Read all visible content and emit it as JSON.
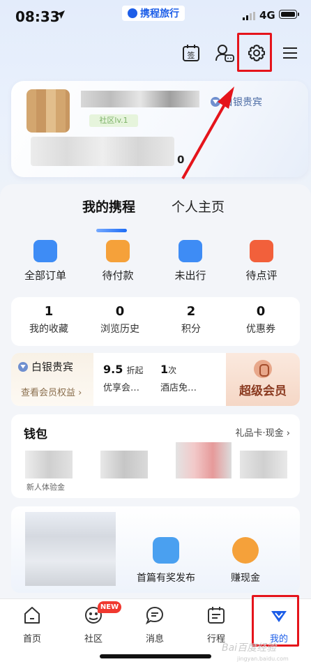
{
  "status": {
    "time": "08:33",
    "network": "4G"
  },
  "brand": {
    "name": "携程旅行"
  },
  "profile": {
    "level_tag": "社区lv.1",
    "vip_label": "白银贵宾",
    "zero_value": "0"
  },
  "tabs": {
    "active": "我的携程",
    "other": "个人主页"
  },
  "orders": [
    {
      "label": "全部订单",
      "color": "#3e8cf5"
    },
    {
      "label": "待付款",
      "color": "#f5a13a"
    },
    {
      "label": "未出行",
      "color": "#3e8cf5"
    },
    {
      "label": "待点评",
      "color": "#f2603b"
    }
  ],
  "stats": [
    {
      "num": "1",
      "label": "我的收藏"
    },
    {
      "num": "0",
      "label": "浏览历史"
    },
    {
      "num": "2",
      "label": "积分"
    },
    {
      "num": "0",
      "label": "优惠券"
    }
  ],
  "member": {
    "tier": "白银贵宾",
    "see_rights": "查看会员权益 ›",
    "benefit1_big": "9.5",
    "benefit1_small": "折起",
    "benefit1_desc": "优享会…",
    "benefit2_big": "1",
    "benefit2_small": "次",
    "benefit2_desc": "酒店免…",
    "super": "超级会员"
  },
  "wallet": {
    "title": "钱包",
    "right": "礼品卡·现金 ›",
    "newuser": "新人体验金"
  },
  "rewards": [
    {
      "label": "首篇有奖发布",
      "color": "#4aa0f0"
    },
    {
      "label": "赚现金",
      "color": "#f5a13a"
    }
  ],
  "nav": [
    {
      "label": "首页",
      "icon": "home-icon"
    },
    {
      "label": "社区",
      "icon": "community-icon"
    },
    {
      "label": "消息",
      "icon": "message-icon"
    },
    {
      "label": "行程",
      "icon": "calendar-icon"
    },
    {
      "label": "我的",
      "icon": "my-icon"
    }
  ],
  "nav_badge": "NEW",
  "watermark": {
    "text": "Bai百度经验",
    "sub": "jingyan.baidu.com"
  },
  "colors": {
    "accent": "#1d5ee8",
    "highlight": "#e5141b"
  }
}
